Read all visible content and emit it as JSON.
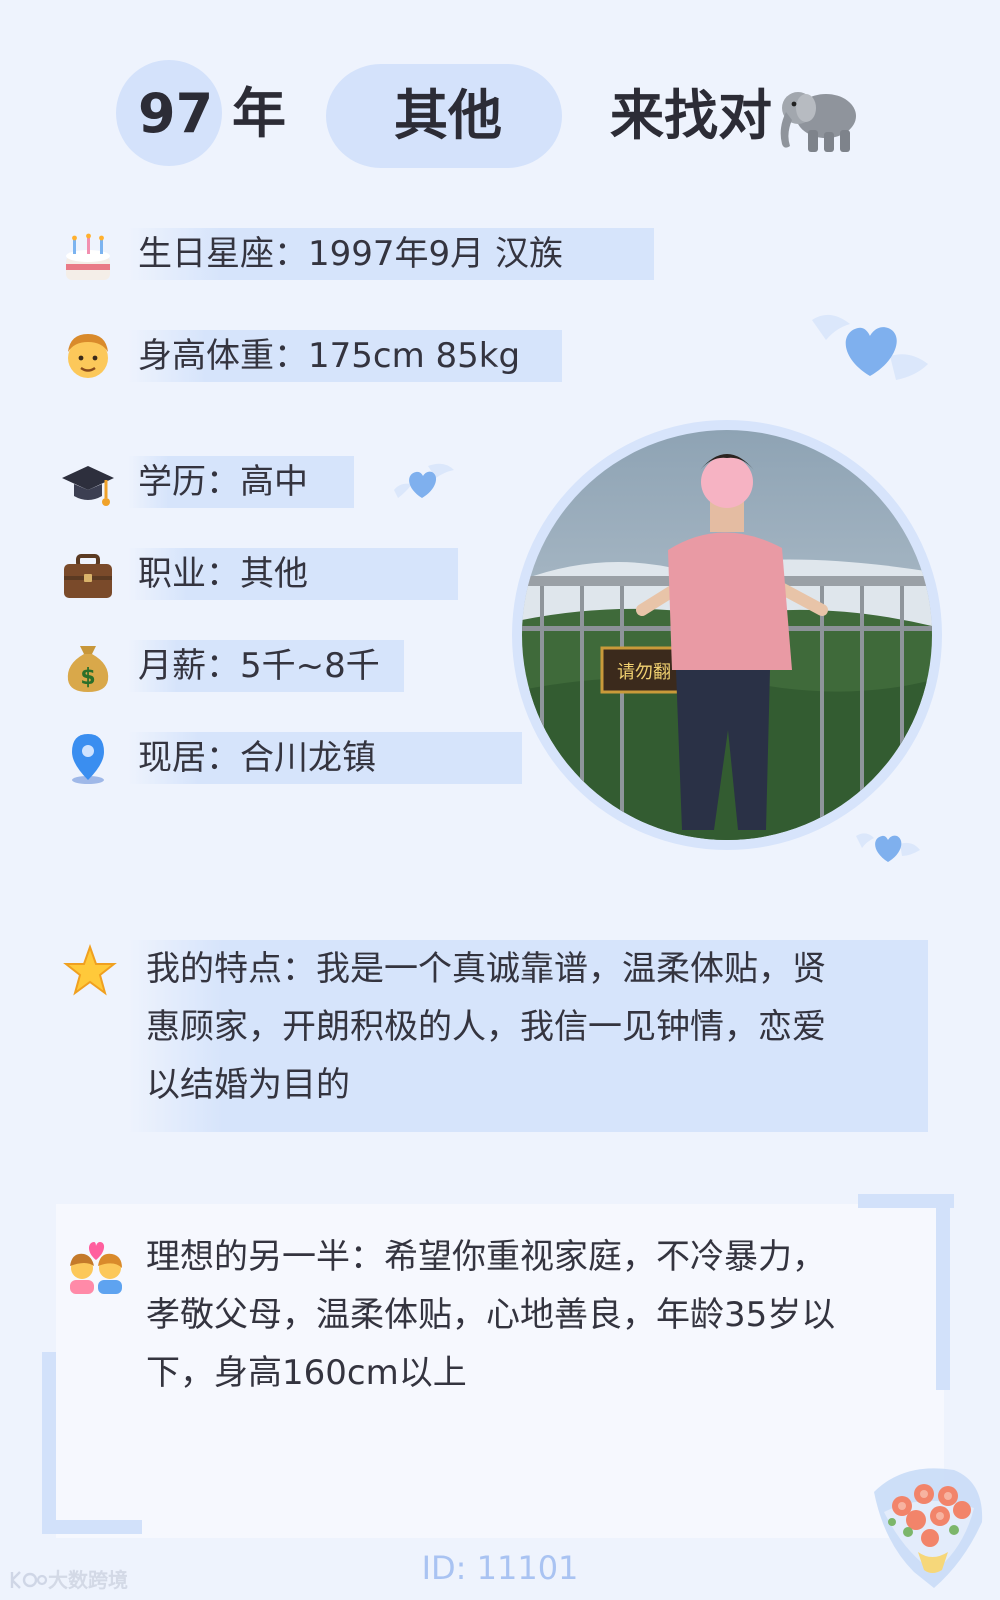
{
  "header": {
    "age_num": "97",
    "age_unit": "年",
    "tag": "其他",
    "title": "来找对"
  },
  "info_rows": [
    {
      "icon": "birthday-cake-icon",
      "text": "生日星座：1997年9月 汉族"
    },
    {
      "icon": "man-face-icon",
      "text": "身高体重：175cm 85kg"
    },
    {
      "icon": "graduation-cap-icon",
      "text": "学历：高中"
    },
    {
      "icon": "briefcase-icon",
      "text": "职业：其他"
    },
    {
      "icon": "money-bag-icon",
      "text": "月薪：5千~8千"
    },
    {
      "icon": "location-pin-icon",
      "text": "现居：合川龙镇"
    }
  ],
  "features": {
    "icon": "star-icon",
    "lines": [
      "我的特点：我是一个真诚靠谱，温柔体贴，贤",
      "惠顾家，开朗积极的人，我信一见钟情，恋爱",
      "以结婚为目的"
    ]
  },
  "ideal": {
    "icon": "couple-with-heart-icon",
    "lines": [
      "理想的另一半：希望你重视家庭，不冷暴力，",
      "孝敬父母，温柔体贴，心地善良，年龄35岁以",
      "下，身高160cm以上"
    ]
  },
  "photo": {
    "sign_text": "请勿翻"
  },
  "footer": {
    "id": "ID: 11101",
    "watermark": "大数跨境"
  },
  "colors": {
    "background": "#eef3fd",
    "accent": "#d4e2fb",
    "heart": "#7fb0ee"
  }
}
